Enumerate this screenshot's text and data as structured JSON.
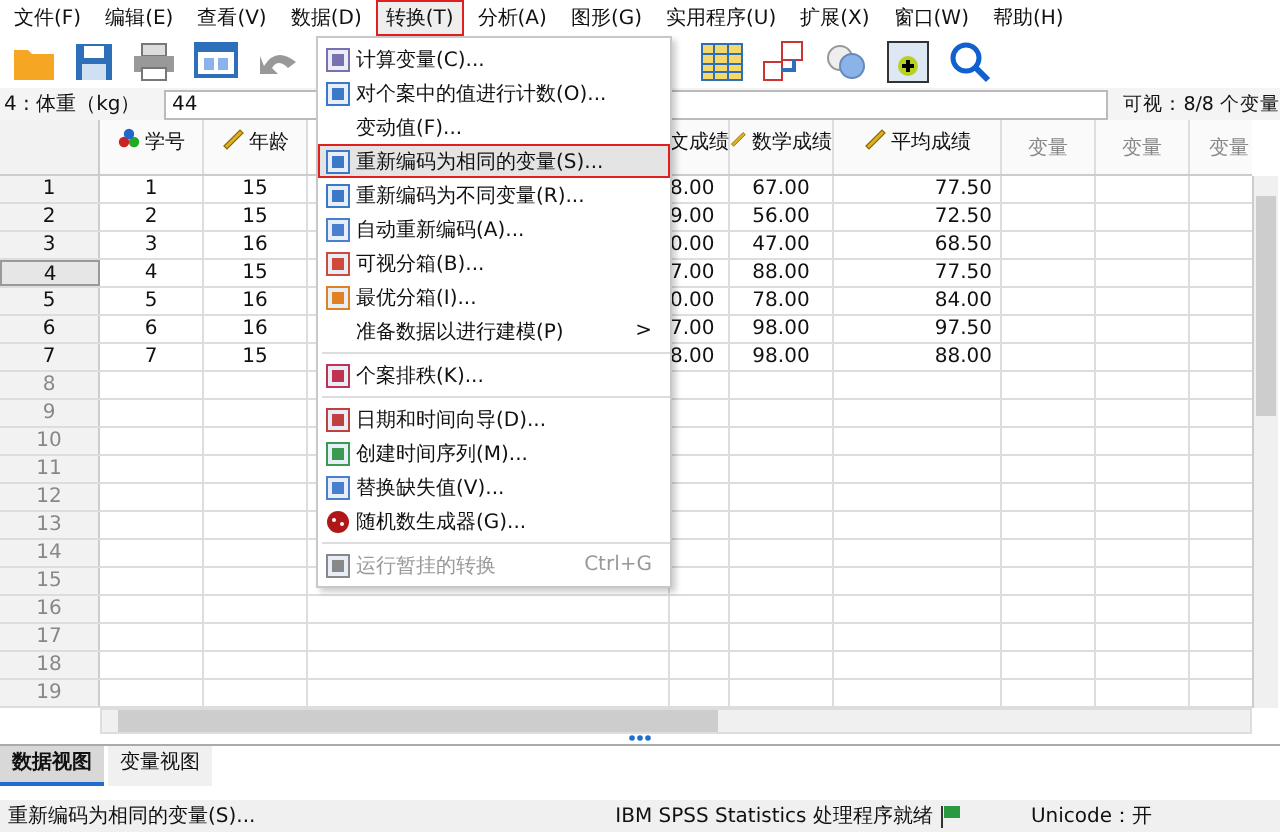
{
  "menu_bar": [
    {
      "label": "文件(F)",
      "open": false
    },
    {
      "label": "编辑(E)",
      "open": false
    },
    {
      "label": "查看(V)",
      "open": false
    },
    {
      "label": "数据(D)",
      "open": false
    },
    {
      "label": "转换(T)",
      "open": true
    },
    {
      "label": "分析(A)",
      "open": false
    },
    {
      "label": "图形(G)",
      "open": false
    },
    {
      "label": "实用程序(U)",
      "open": false
    },
    {
      "label": "扩展(X)",
      "open": false
    },
    {
      "label": "窗口(W)",
      "open": false
    },
    {
      "label": "帮助(H)",
      "open": false
    }
  ],
  "cell_editor": {
    "reference": "4 : 体重（kg）",
    "value": "44",
    "visible_count": "可视：8/8 个变量"
  },
  "data_grid": {
    "columns": [
      {
        "label": "学号",
        "kind": "nominal"
      },
      {
        "label": "年龄",
        "kind": "scale"
      },
      {
        "label": "文成绩",
        "kind": "partial"
      },
      {
        "label": "数学成绩",
        "kind": "scale"
      },
      {
        "label": "平均成绩",
        "kind": "scale"
      },
      {
        "label": "变量",
        "kind": "empty"
      },
      {
        "label": "变量",
        "kind": "empty"
      },
      {
        "label": "变量",
        "kind": "empty"
      }
    ],
    "rows": [
      {
        "number": "1",
        "selected": false,
        "cells": [
          "1",
          "15",
          "8.00",
          "67.00",
          "77.50"
        ]
      },
      {
        "number": "2",
        "selected": false,
        "cells": [
          "2",
          "15",
          "9.00",
          "56.00",
          "72.50"
        ]
      },
      {
        "number": "3",
        "selected": false,
        "cells": [
          "3",
          "16",
          "0.00",
          "47.00",
          "68.50"
        ]
      },
      {
        "number": "4",
        "selected": true,
        "cells": [
          "4",
          "15",
          "7.00",
          "88.00",
          "77.50"
        ]
      },
      {
        "number": "5",
        "selected": false,
        "cells": [
          "5",
          "16",
          "0.00",
          "78.00",
          "84.00"
        ]
      },
      {
        "number": "6",
        "selected": false,
        "cells": [
          "6",
          "16",
          "7.00",
          "98.00",
          "97.50"
        ]
      },
      {
        "number": "7",
        "selected": false,
        "cells": [
          "7",
          "15",
          "8.00",
          "98.00",
          "88.00"
        ]
      },
      {
        "number": "8",
        "selected": false,
        "cells": []
      },
      {
        "number": "9",
        "selected": false,
        "cells": []
      },
      {
        "number": "10",
        "selected": false,
        "cells": []
      },
      {
        "number": "11",
        "selected": false,
        "cells": []
      },
      {
        "number": "12",
        "selected": false,
        "cells": []
      },
      {
        "number": "13",
        "selected": false,
        "cells": []
      },
      {
        "number": "14",
        "selected": false,
        "cells": []
      },
      {
        "number": "15",
        "selected": false,
        "cells": []
      },
      {
        "number": "16",
        "selected": false,
        "cells": []
      },
      {
        "number": "17",
        "selected": false,
        "cells": []
      },
      {
        "number": "18",
        "selected": false,
        "cells": []
      },
      {
        "number": "19",
        "selected": false,
        "cells": []
      }
    ]
  },
  "dropdown_menu": [
    {
      "kind": "item",
      "label": "计算变量(C)...",
      "has_icon": true,
      "selected": false,
      "disabled": false
    },
    {
      "kind": "item",
      "label": "对个案中的值进行计数(O)...",
      "has_icon": true,
      "selected": false,
      "disabled": false
    },
    {
      "kind": "item",
      "label": "变动值(F)...",
      "has_icon": false,
      "selected": false,
      "disabled": false
    },
    {
      "kind": "item",
      "label": "重新编码为相同的变量(S)...",
      "has_icon": true,
      "selected": true,
      "disabled": false
    },
    {
      "kind": "item",
      "label": "重新编码为不同变量(R)...",
      "has_icon": true,
      "selected": false,
      "disabled": false
    },
    {
      "kind": "item",
      "label": "自动重新编码(A)...",
      "has_icon": true,
      "selected": false,
      "disabled": false
    },
    {
      "kind": "item",
      "label": "可视分箱(B)...",
      "has_icon": true,
      "selected": false,
      "disabled": false
    },
    {
      "kind": "item",
      "label": "最优分箱(I)...",
      "has_icon": true,
      "selected": false,
      "disabled": false
    },
    {
      "kind": "submenu",
      "label": "准备数据以进行建模(P)",
      "submenu_arrow": ">",
      "has_icon": false,
      "selected": false,
      "disabled": false
    },
    {
      "kind": "separator"
    },
    {
      "kind": "item",
      "label": "个案排秩(K)...",
      "has_icon": true,
      "selected": false,
      "disabled": false
    },
    {
      "kind": "separator"
    },
    {
      "kind": "item",
      "label": "日期和时间向导(D)...",
      "has_icon": true,
      "selected": false,
      "disabled": false
    },
    {
      "kind": "item",
      "label": "创建时间序列(M)...",
      "has_icon": true,
      "selected": false,
      "disabled": false
    },
    {
      "kind": "item",
      "label": "替换缺失值(V)...",
      "has_icon": true,
      "selected": false,
      "disabled": false
    },
    {
      "kind": "item",
      "label": "随机数生成器(G)...",
      "has_icon": true,
      "selected": false,
      "disabled": false
    },
    {
      "kind": "separator"
    },
    {
      "kind": "item",
      "label": "运行暂挂的转换",
      "shortcut": "Ctrl+G",
      "has_icon": true,
      "selected": false,
      "disabled": true
    }
  ],
  "view_tabs": [
    {
      "label": "数据视图",
      "selected": true
    },
    {
      "label": "变量视图",
      "selected": false
    }
  ],
  "status_bar": {
    "message": "重新编码为相同的变量(S)...",
    "processor_status": "IBM SPSS Statistics 处理程序就绪",
    "unicode": "Unicode：开"
  }
}
